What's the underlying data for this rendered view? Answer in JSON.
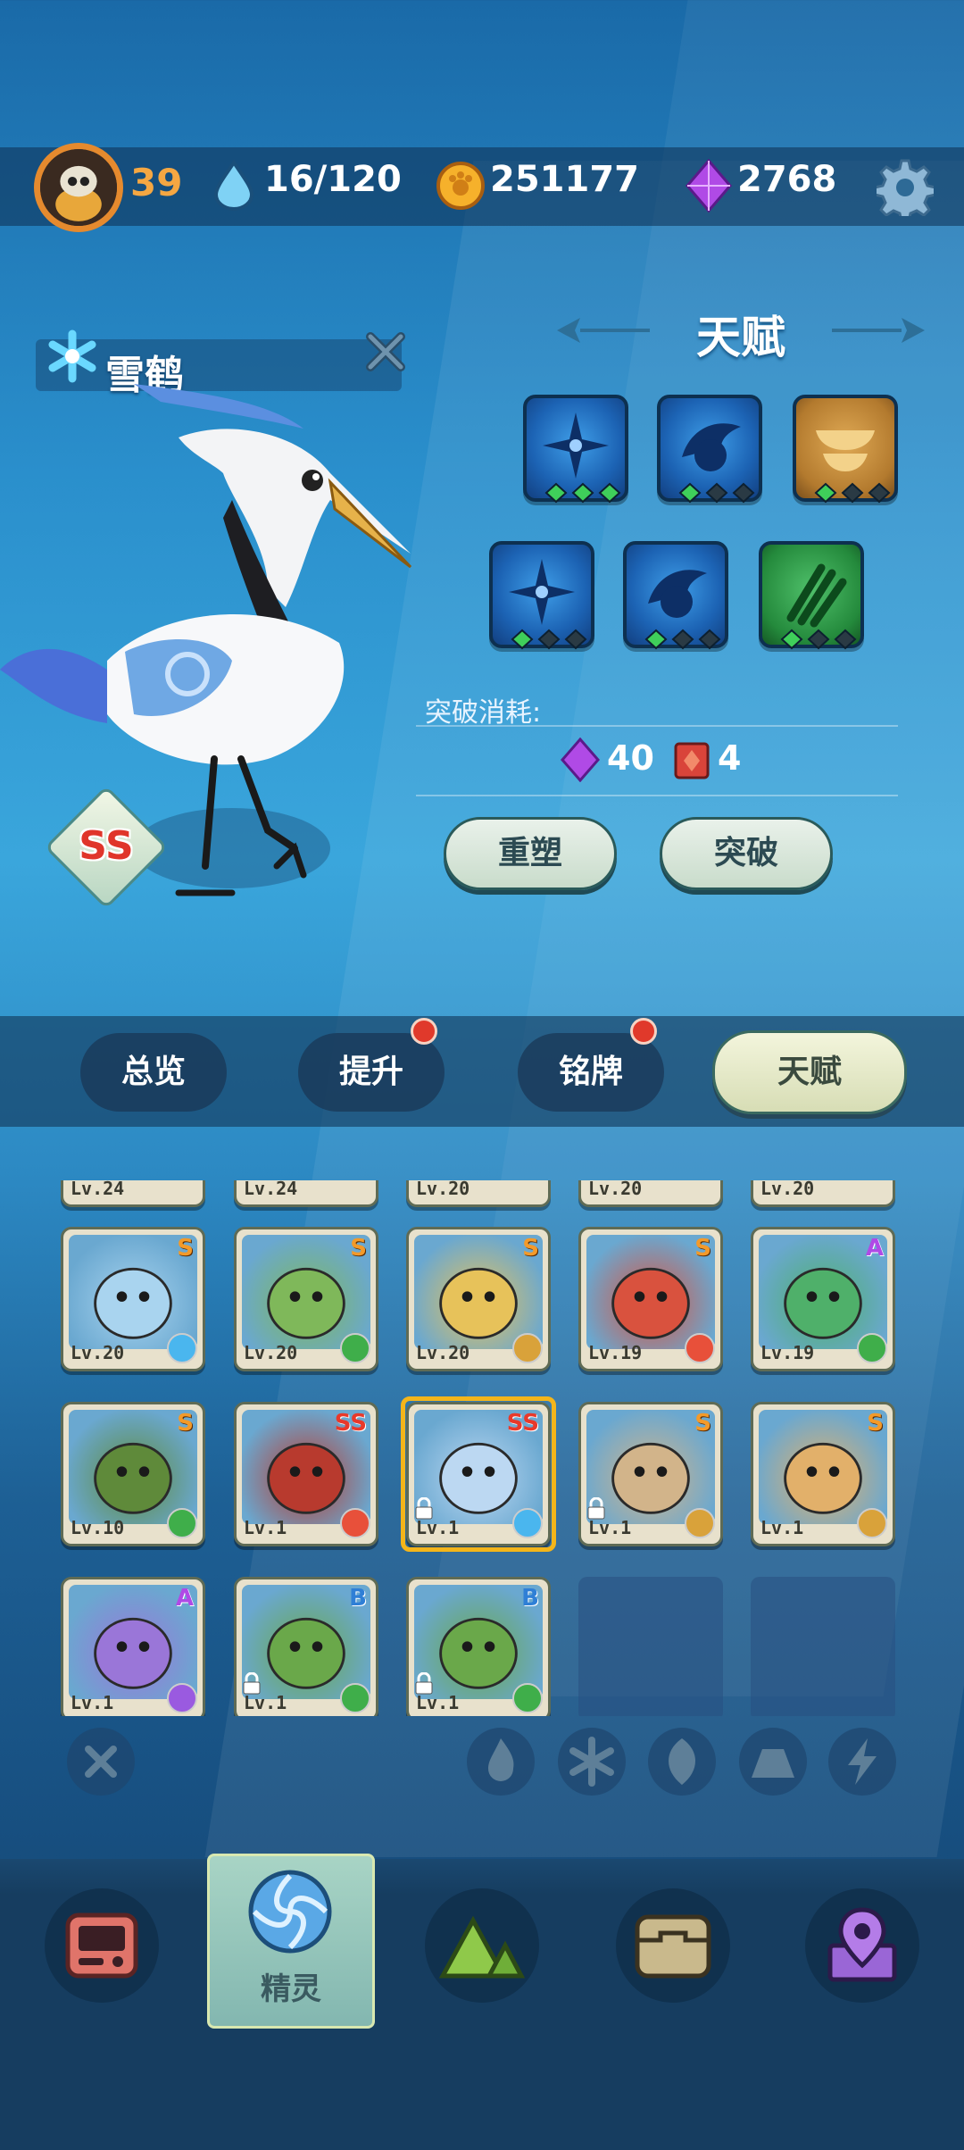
{
  "header": {
    "player_level": "39",
    "stamina": "16/120",
    "coins": "251177",
    "gems": "2768"
  },
  "pet": {
    "name": "雪鹤",
    "rank": "SS"
  },
  "talent": {
    "title": "天赋",
    "skills": [
      {
        "icon": "shuriken-icon",
        "color": "blue",
        "level": 3
      },
      {
        "icon": "fin-icon",
        "color": "blue",
        "level": 1
      },
      {
        "icon": "bowls-icon",
        "color": "gold",
        "level": 1
      },
      {
        "icon": "shuriken-icon",
        "color": "blue",
        "level": 1
      },
      {
        "icon": "fin-icon",
        "color": "blue",
        "level": 1
      },
      {
        "icon": "claw-icon",
        "color": "green",
        "level": 1
      }
    ],
    "cost_label": "突破消耗:",
    "cost_gems": "40",
    "cost_books": "4",
    "reshape_label": "重塑",
    "breakthrough_label": "突破"
  },
  "tabs": [
    {
      "label": "总览",
      "badge": false
    },
    {
      "label": "提升",
      "badge": true
    },
    {
      "label": "铭牌",
      "badge": true
    },
    {
      "label": "天赋",
      "badge": false,
      "active": true
    }
  ],
  "roster": {
    "partial_row": [
      "Lv.24",
      "Lv.24",
      "Lv.20",
      "Lv.20",
      "Lv.20"
    ],
    "cards": [
      {
        "level": "Lv.20",
        "rank": "S",
        "element": "ice",
        "creature": "tiger"
      },
      {
        "level": "Lv.20",
        "rank": "S",
        "element": "grass",
        "creature": "tree"
      },
      {
        "level": "Lv.20",
        "rank": "S",
        "element": "earth",
        "creature": "skullpup"
      },
      {
        "level": "Lv.19",
        "rank": "S",
        "element": "fire",
        "creature": "dragon"
      },
      {
        "level": "Lv.19",
        "rank": "A",
        "element": "grass",
        "creature": "snake"
      },
      {
        "level": "Lv.10",
        "rank": "S",
        "element": "grass",
        "creature": "hood"
      },
      {
        "level": "Lv.1",
        "rank": "SS",
        "element": "fire",
        "creature": "bull"
      },
      {
        "level": "Lv.1",
        "rank": "SS",
        "element": "ice",
        "creature": "crane",
        "selected": true,
        "locked": true
      },
      {
        "level": "Lv.1",
        "rank": "S",
        "element": "earth",
        "creature": "goat",
        "locked": true
      },
      {
        "level": "Lv.1",
        "rank": "S",
        "element": "earth",
        "creature": "blob"
      },
      {
        "level": "Lv.1",
        "rank": "A",
        "element": "electric",
        "creature": "boar"
      },
      {
        "level": "Lv.1",
        "rank": "B",
        "element": "grass",
        "creature": "monkey",
        "locked": true
      },
      {
        "level": "Lv.1",
        "rank": "B",
        "element": "grass",
        "creature": "monkey",
        "locked": true
      }
    ]
  },
  "filters": [
    "close-icon",
    "fire-icon",
    "ice-icon",
    "grass-icon",
    "earth-icon",
    "electric-icon"
  ],
  "nav": {
    "items": [
      "console-icon",
      "spirit-icon",
      "mountain-icon",
      "chest-icon",
      "map-pin-icon"
    ],
    "active_label": "精灵"
  },
  "colors": {
    "accent_orange": "#f5a742",
    "rank_ss": "#e0352a",
    "rank_a": "#b04ae6",
    "rank_b": "#2f7fd6"
  }
}
